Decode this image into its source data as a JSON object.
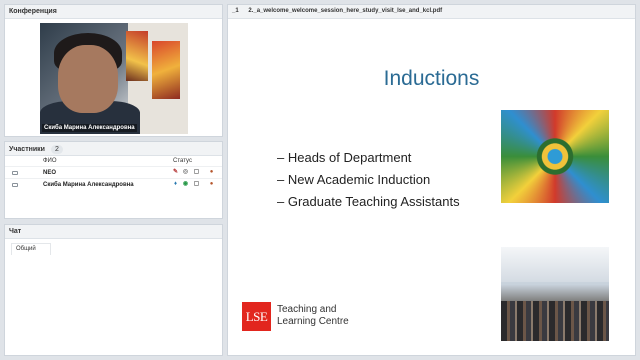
{
  "conference": {
    "title": "Конференция",
    "video_name": "Скиба Марина Александровна"
  },
  "participants": {
    "title": "Участники",
    "count": "2",
    "col_name": "ФИО",
    "col_status": "Статус",
    "rows": [
      {
        "name": "NEO"
      },
      {
        "name": "Скиба Марина Александровна"
      }
    ]
  },
  "chat": {
    "title": "Чат",
    "tab_label": "Общий"
  },
  "document": {
    "page_number": "_1",
    "filename": "2._a_welcome_welcome_session_here_study_visit_lse_and_kcl.pdf",
    "slide": {
      "title": "Inductions",
      "bullets": [
        "– Heads of Department",
        "– New Academic Induction",
        "– Graduate Teaching Assistants"
      ],
      "logo": "LSE",
      "logo_text_line1": "Teaching and",
      "logo_text_line2": "Learning Centre"
    }
  },
  "colors": {
    "title_blue": "#2b6b94",
    "lse_red": "#e2261e"
  }
}
